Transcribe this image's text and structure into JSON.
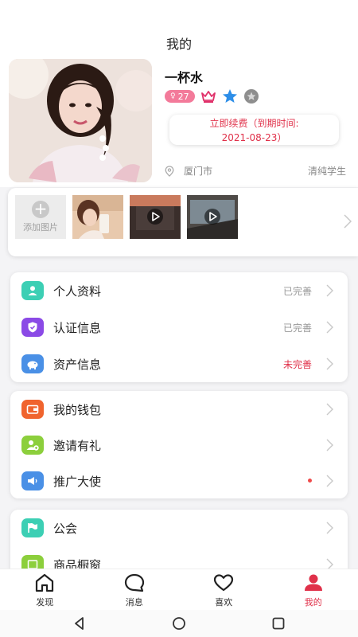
{
  "header": {
    "title": "我的"
  },
  "profile": {
    "name": "一杯水",
    "age": "27",
    "renew_line1": "立即续费（到期时间:",
    "renew_line2": "2021-08-23）",
    "city": "厦门市",
    "tag": "清纯学生"
  },
  "gallery": {
    "add_label": "添加图片"
  },
  "menu_group_1": [
    {
      "label": "个人资料",
      "status": "已完善"
    },
    {
      "label": "认证信息",
      "status": "已完善"
    },
    {
      "label": "资产信息",
      "status": "未完善"
    }
  ],
  "menu_group_2": [
    {
      "label": "我的钱包"
    },
    {
      "label": "邀请有礼"
    },
    {
      "label": "推广大使"
    }
  ],
  "menu_group_3": [
    {
      "label": "公会"
    },
    {
      "label": "商品橱窗"
    }
  ],
  "bottom_nav": [
    {
      "label": "发现",
      "icon": "home-icon"
    },
    {
      "label": "消息",
      "icon": "message-icon"
    },
    {
      "label": "喜欢",
      "icon": "heart-icon"
    },
    {
      "label": "我的",
      "icon": "person-icon"
    }
  ],
  "colors": {
    "accent": "#e0314a",
    "age_badge": "#f37a9a",
    "icon_teal": "#3ccfb4",
    "icon_purple": "#8b4ae6",
    "icon_blue": "#4a90e6",
    "icon_orange": "#f0642e",
    "icon_green": "#8ccf3c"
  }
}
